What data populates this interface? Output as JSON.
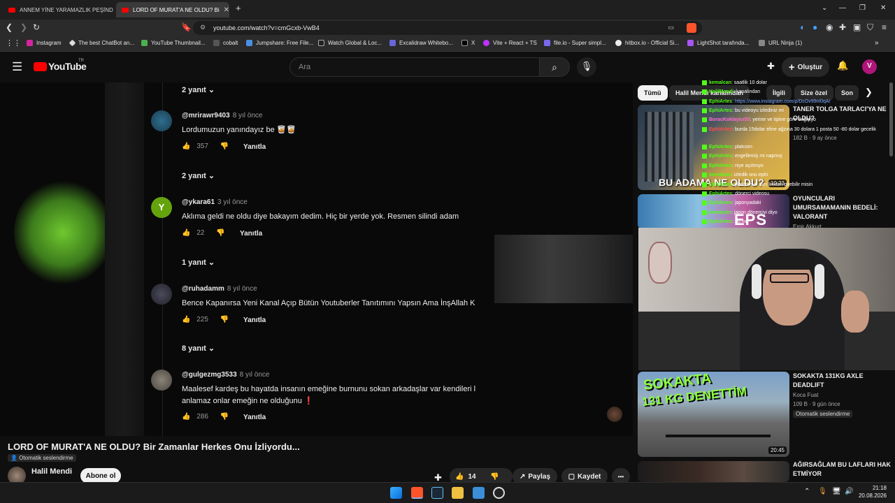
{
  "tabs": [
    {
      "label": "ANNEM YİNE YARAMAZLIK PEŞİNDE"
    },
    {
      "label": "LORD OF MURAT'A NE OLDU? Bi"
    }
  ],
  "address": {
    "url": "youtube.com/watch?v=cmGcxb-VwB4"
  },
  "bookmarks": [
    "Instagram",
    "The best ChatBot an...",
    "YouTube Thumbnail...",
    "cobalt",
    "Jumpshare: Free File...",
    "Watch Global & Loc...",
    "Excalidraw Whitebo...",
    "X",
    "Vite + React + TS",
    "file.io - Super simpl...",
    "hitbox.io - Official Si...",
    "LightShot tarafında...",
    "URL Ninja (1)"
  ],
  "youtube": {
    "logo": "YouTube",
    "region": "TR",
    "search_placeholder": "Ara",
    "create_label": "Oluştur",
    "avatar_letter": "V"
  },
  "comments": [
    {
      "user": "@mrirawr9403",
      "time": "8 yıl önce",
      "text": "Lordumuzun yanındayız be 🥃🥃",
      "likes": "357",
      "reply": "Yanıtla",
      "replies": "2 yanıt"
    },
    {
      "user": "@ykara61",
      "time": "3 yıl önce",
      "text": "Aklıma geldi ne oldu diye bakayım dedim. Hiç bir yerde yok. Resmen silindi adam",
      "likes": "22",
      "reply": "Yanıtla",
      "replies": "1 yanıt",
      "avatar_letter": "Y"
    },
    {
      "user": "@ruhadamm",
      "time": "8 yıl önce",
      "text": "Bence Kapanırsa Yeni Kanal Açıp Bütün Youtuberler Tanıtımını Yapsın Ama İnşAllah K",
      "likes": "225",
      "reply": "Yanıtla",
      "replies": "8 yanıt"
    },
    {
      "user": "@gulgezmg3533",
      "time": "8 yıl önce",
      "text1": "Maalesef kardeş bu hayatda insanın emeğine burnunu sokan arkadaşlar var kendileri l",
      "text2": "anlamaz onlar emeğin ne olduğunu ❗",
      "likes": "286",
      "reply": "Yanıtla"
    }
  ],
  "top_replies": "2 yanıt",
  "video": {
    "title": "LORD OF MURAT'A NE OLDU? Bir Zamanlar Herkes Onu İzliyordu...",
    "auto_dub": "Otomatik seslendirme",
    "channel": "Halil Mendi",
    "subscribe": "Abone ol",
    "likes": "14",
    "share": "Paylaş",
    "save": "Kaydet",
    "more": "•••"
  },
  "chips": [
    "Tümü",
    "Halil Mendi kanalından",
    "İlgili",
    "Size özel",
    "Son"
  ],
  "sidebar_videos": [
    {
      "title": "TANER TOLGA TARLACI'YA NE OLDU?",
      "meta": "182 B · 9 ay önce",
      "thumb_text": "BU ADAMA NE OLDU?",
      "duration": "10:23"
    },
    {
      "title": "OYUNCULARI UMURSAMAMANIN BEDELİ: VALORANT",
      "meta": "Emir Akkurt",
      "thumb_text": "EPS"
    },
    {
      "title": "SOKAKTA 131KG AXLE DEADLIFT",
      "channel": "Koca Fuat",
      "meta": "109 B · 9 gün önce",
      "auto_dub": "Otomatik seslendirme",
      "thumb_text1": "SOKAKTA",
      "thumb_text2": "131 KG DENETTİM",
      "duration": "20:45"
    },
    {
      "title": "AĞIRSAĞLAM BU LAFLARI HAK ETMİYOR"
    }
  ],
  "chat": [
    {
      "name": "kemalcan",
      "msg": ": saatlik 10 dolar"
    },
    {
      "name": "HalilMendi",
      "msg": ": kanalından"
    },
    {
      "name": "EphiArtes",
      "msg": ": https://www.instagram.com/p/DcOv99nl0qA/"
    },
    {
      "name": "EphiArtes",
      "msg": ": bu videoyu izlediniz mi"
    },
    {
      "name": "BoracKoklayicı55",
      "msg": ": yerine ve tipine göre değişiyo"
    },
    {
      "name": "EphiArtes",
      "msg": ": burda 15dolar eline ağzına 30 dolara 1 posta 50 -80 dolar gecelik"
    },
    {
      "name": "EphiArtes",
      "msg": ": platcorn"
    },
    {
      "name": "EphiArtes",
      "msg": ": engellemiş mi napmış"
    },
    {
      "name": "EphiArtes",
      "msg": ": niye açılmıyo"
    },
    {
      "name": "kemalcan",
      "msg": ": izledik onu ephi"
    },
    {
      "name": "EphiArtes",
      "msg": ": platcornun ayrı linkten girebilir misin"
    },
    {
      "name": "EphiArtes",
      "msg": ": dönerci videosu"
    },
    {
      "name": "EphiArtes",
      "msg": ": japonyadaki"
    },
    {
      "name": "kemalcan",
      "msg": ": japon dönerciyi diyo"
    },
    {
      "name": "EphiArtes",
      "msg": ": bu ne"
    }
  ],
  "clock": {
    "time": "21:18",
    "date": "20.08.2026"
  }
}
